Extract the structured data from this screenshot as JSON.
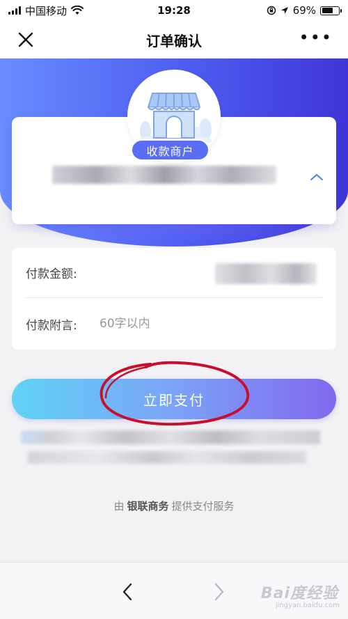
{
  "status_bar": {
    "carrier": "中国移动",
    "time": "19:28",
    "battery": "69%",
    "battery_level": 0.69
  },
  "nav": {
    "title": "订单确认",
    "more": "•••"
  },
  "merchant": {
    "badge": "收款商户"
  },
  "form": {
    "amount_label": "付款金额:",
    "note_label": "付款附言:",
    "note_placeholder": "60字以内"
  },
  "pay_button": {
    "label": "立即支付"
  },
  "footer": {
    "prefix": "由",
    "brand": "银联商务",
    "suffix": "提供支付服务"
  },
  "watermark": {
    "text": "Bai度经验",
    "sub": "jingyan.baidu.com"
  },
  "colors": {
    "hero_start": "#6a8cff",
    "hero_end": "#4035d8",
    "badge": "#5a6ef5",
    "button_start": "#5fd3f4",
    "button_end": "#8268ee",
    "annotation": "#c8102e"
  }
}
